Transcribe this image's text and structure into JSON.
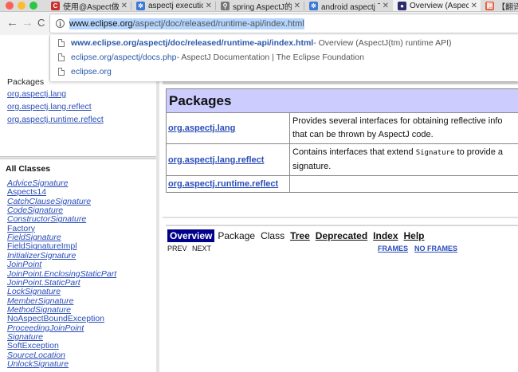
{
  "browser": {
    "tabs": [
      {
        "favicon": "C",
        "favicon_color": "#c9302c",
        "title": "使用@Aspect做a",
        "close": "✕"
      },
      {
        "favicon": "✲",
        "favicon_color": "#3b78d8",
        "title": "aspectj executio",
        "close": "✕"
      },
      {
        "favicon": "⚲",
        "favicon_color": "#777777",
        "title": "spring AspectJ的",
        "close": "✕"
      },
      {
        "favicon": "✲",
        "favicon_color": "#3b78d8",
        "title": "android aspectj 下",
        "close": "✕"
      },
      {
        "favicon": "●",
        "favicon_color": "#2b2b6e",
        "title": "Overview (Aspec",
        "close": "✕"
      },
      {
        "favicon": "翻",
        "favicon_color": "#e25a3a",
        "title": "【翻译",
        "close": ""
      }
    ],
    "nav": {
      "back": "←",
      "forward": "→",
      "reload": "C"
    },
    "address": {
      "info_icon": "i",
      "host": "www.eclipse.org",
      "path": "/aspectj/doc/released/runtime-api/index.html"
    },
    "suggestions": [
      {
        "url_bold": "www.eclipse.org/aspectj/doc/released/runtime-api/index.html",
        "url_plain": "",
        "title": " - Overview (AspectJ(tm) runtime API)"
      },
      {
        "url_bold": "",
        "url_plain": "eclipse.org/aspectj/docs.php",
        "title": " - AspectJ Documentation | The Eclipse Foundation"
      },
      {
        "url_bold": "",
        "url_plain": "eclipse.org",
        "title": ""
      }
    ]
  },
  "left": {
    "packages_heading": "Packages",
    "packages": [
      "org.aspectj.lang",
      "org.aspectj.lang.reflect",
      "org.aspectj.runtime.reflect"
    ],
    "all_classes_heading": "All Classes",
    "classes": [
      {
        "name": "AdviceSignature",
        "italic": true
      },
      {
        "name": "Aspects14",
        "italic": false
      },
      {
        "name": "CatchClauseSignature",
        "italic": true
      },
      {
        "name": "CodeSignature",
        "italic": true
      },
      {
        "name": "ConstructorSignature",
        "italic": true
      },
      {
        "name": "Factory",
        "italic": false
      },
      {
        "name": "FieldSignature",
        "italic": true
      },
      {
        "name": "FieldSignatureImpl",
        "italic": false
      },
      {
        "name": "InitializerSignature",
        "italic": true
      },
      {
        "name": "JoinPoint",
        "italic": true
      },
      {
        "name": "JoinPoint.EnclosingStaticPart",
        "italic": true
      },
      {
        "name": "JoinPoint.StaticPart",
        "italic": true
      },
      {
        "name": "LockSignature",
        "italic": true
      },
      {
        "name": "MemberSignature",
        "italic": true
      },
      {
        "name": "MethodSignature",
        "italic": true
      },
      {
        "name": "NoAspectBoundException",
        "italic": false
      },
      {
        "name": "ProceedingJoinPoint",
        "italic": true
      },
      {
        "name": "Signature",
        "italic": true
      },
      {
        "name": "SoftException",
        "italic": false
      },
      {
        "name": "SourceLocation",
        "italic": true
      },
      {
        "name": "UnlockSignature",
        "italic": true
      }
    ]
  },
  "main": {
    "table_title": "Packages",
    "rows": [
      {
        "name": "org.aspectj.lang",
        "desc_pre": "Provides several interfaces for obtaining reflective info",
        "desc_code": "",
        "desc_post": "that can be thrown by AspectJ code."
      },
      {
        "name": "org.aspectj.lang.reflect",
        "desc_pre": "Contains interfaces that extend ",
        "desc_code": "Signature",
        "desc_post": " to provide a",
        "desc_line2": "signature."
      },
      {
        "name": "org.aspectj.runtime.reflect",
        "desc_pre": "",
        "desc_code": "",
        "desc_post": ""
      }
    ],
    "navbar": {
      "overview": "Overview",
      "package": "Package",
      "class": "Class",
      "tree": "Tree",
      "deprecated": "Deprecated",
      "index": "Index",
      "help": "Help",
      "prev": "PREV",
      "next": "NEXT",
      "frames": "FRAMES",
      "no_frames": "NO FRAMES"
    }
  },
  "colors": {
    "link": "#2a4db8",
    "table_header": "#ccccff",
    "navbar_active": "#00008b",
    "address_highlight": "#b4d5fe"
  }
}
